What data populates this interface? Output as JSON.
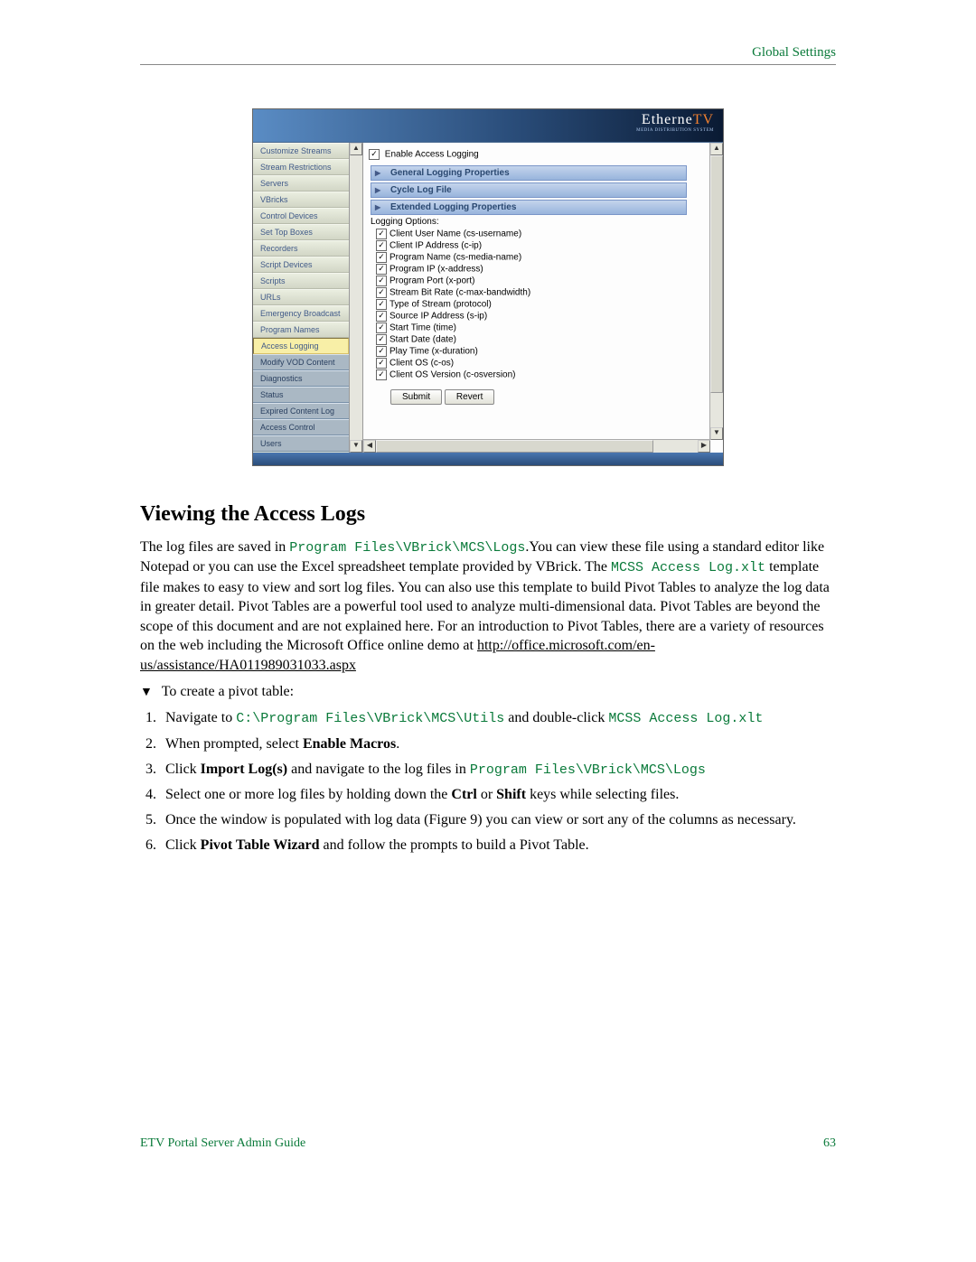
{
  "header": {
    "right_label": "Global Settings"
  },
  "screenshot": {
    "logo": {
      "text_a": "Etherne",
      "text_b": "TV",
      "sub": "MEDIA DISTRIBUTION SYSTEM"
    },
    "sidebar": {
      "items": [
        {
          "label": "Customize Streams",
          "kind": "normal"
        },
        {
          "label": "Stream Restrictions",
          "kind": "normal"
        },
        {
          "label": "Servers",
          "kind": "normal"
        },
        {
          "label": "VBricks",
          "kind": "normal"
        },
        {
          "label": "Control Devices",
          "kind": "normal"
        },
        {
          "label": "Set Top Boxes",
          "kind": "normal"
        },
        {
          "label": "Recorders",
          "kind": "normal"
        },
        {
          "label": "Script Devices",
          "kind": "normal"
        },
        {
          "label": "Scripts",
          "kind": "normal"
        },
        {
          "label": "URLs",
          "kind": "normal"
        },
        {
          "label": "Emergency Broadcast",
          "kind": "normal"
        },
        {
          "label": "Program Names",
          "kind": "normal"
        },
        {
          "label": "Access Logging",
          "kind": "highlight"
        },
        {
          "label": "Modify VOD Content",
          "kind": "section"
        },
        {
          "label": "Diagnostics",
          "kind": "section"
        },
        {
          "label": "Status",
          "kind": "section"
        },
        {
          "label": "Expired Content Log",
          "kind": "section"
        },
        {
          "label": "Access Control",
          "kind": "section"
        },
        {
          "label": "Users",
          "kind": "section"
        }
      ]
    },
    "enable_label": "Enable Access Logging",
    "sections": {
      "s1": "General Logging Properties",
      "s2": "Cycle Log File",
      "s3": "Extended Logging Properties"
    },
    "logging_options_label": "Logging Options:",
    "options": [
      "Client User Name (cs-username)",
      "Client IP Address (c-ip)",
      "Program Name (cs-media-name)",
      "Program IP (x-address)",
      "Program Port (x-port)",
      "Stream Bit Rate (c-max-bandwidth)",
      "Type of Stream (protocol)",
      "Source IP Address (s-ip)",
      "Start Time (time)",
      "Start Date (date)",
      "Play Time (x-duration)",
      "Client OS (c-os)",
      "Client OS Version (c-osversion)"
    ],
    "buttons": {
      "submit": "Submit",
      "revert": "Revert"
    }
  },
  "doc": {
    "heading": "Viewing the Access Logs",
    "para": {
      "t1": "The log files are saved in ",
      "path1": "Program Files\\VBrick\\MCS\\Logs",
      "t2": ".You can view these file using a standard editor like Notepad or you can use the Excel spreadsheet template provided by VBrick. The ",
      "path2": "MCSS Access Log.xlt",
      "t3": " template file makes to easy to view and sort log files. You can also use this template to build Pivot Tables to analyze the log data in greater detail. Pivot Tables are a powerful tool used to analyze multi-dimensional data. Pivot Tables are beyond the scope of this document and are not explained here. For an introduction to Pivot Tables, there are a variety of resources on the web including the Microsoft Office online demo at ",
      "link": "http://office.microsoft.com/en-us/assistance/HA011989031033.aspx"
    },
    "task": "To create a pivot table:",
    "steps": {
      "s1a": "Navigate to ",
      "s1p": "C:\\Program Files\\VBrick\\MCS\\Utils",
      "s1b": " and double-click ",
      "s1p2": "MCSS Access Log.xlt",
      "s2a": "When prompted, select ",
      "s2b": "Enable Macros",
      "s2c": ".",
      "s3a": "Click ",
      "s3b": "Import Log(s)",
      "s3c": " and navigate to the log files in ",
      "s3p": "Program Files\\VBrick\\MCS\\Logs",
      "s4a": "Select one or more log files by holding down the ",
      "s4b": "Ctrl",
      "s4c": " or ",
      "s4d": "Shift",
      "s4e": " keys while selecting files.",
      "s5": "Once the window is populated with log data (Figure 9) you can view or sort any of the columns as necessary.",
      "s6a": "Click ",
      "s6b": "Pivot Table Wizard",
      "s6c": " and follow the prompts to build a Pivot Table."
    }
  },
  "footer": {
    "left": "ETV Portal Server Admin Guide",
    "right": "63"
  }
}
